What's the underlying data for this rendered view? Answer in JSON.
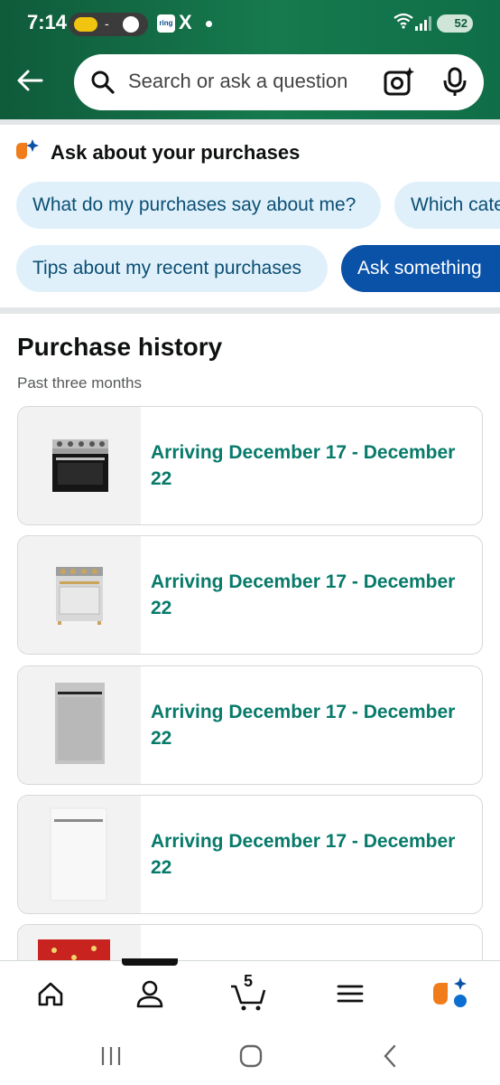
{
  "status_bar": {
    "time": "7:14",
    "separator": "-",
    "ring_label": "ring",
    "x_label": "X",
    "battery": "52"
  },
  "search": {
    "placeholder": "Search or ask a question"
  },
  "ask": {
    "title": "Ask about your purchases",
    "chips": [
      "What do my purchases say about me?",
      "Which categ",
      "Tips about my recent purchases",
      "Ask something"
    ]
  },
  "purchase_history": {
    "title": "Purchase history",
    "subtitle": "Past three months",
    "items": [
      {
        "status": "Arriving December 17 - December 22",
        "product": "black-range"
      },
      {
        "status": "Arriving December 17 - December 22",
        "product": "steel-range"
      },
      {
        "status": "Arriving December 17 - December 22",
        "product": "steel-dishwasher"
      },
      {
        "status": "Arriving December 17 - December 22",
        "product": "white-dishwasher"
      }
    ]
  },
  "bottom_nav": {
    "cart_count": "5",
    "items": [
      "home-icon",
      "account-icon",
      "cart-icon",
      "menu-icon",
      "rufus-icon"
    ]
  },
  "colors": {
    "header_green": "#167a4e",
    "chip_bg": "#e0f0fb",
    "chip_active": "#0a51a8",
    "status_teal": "#077a6a"
  }
}
